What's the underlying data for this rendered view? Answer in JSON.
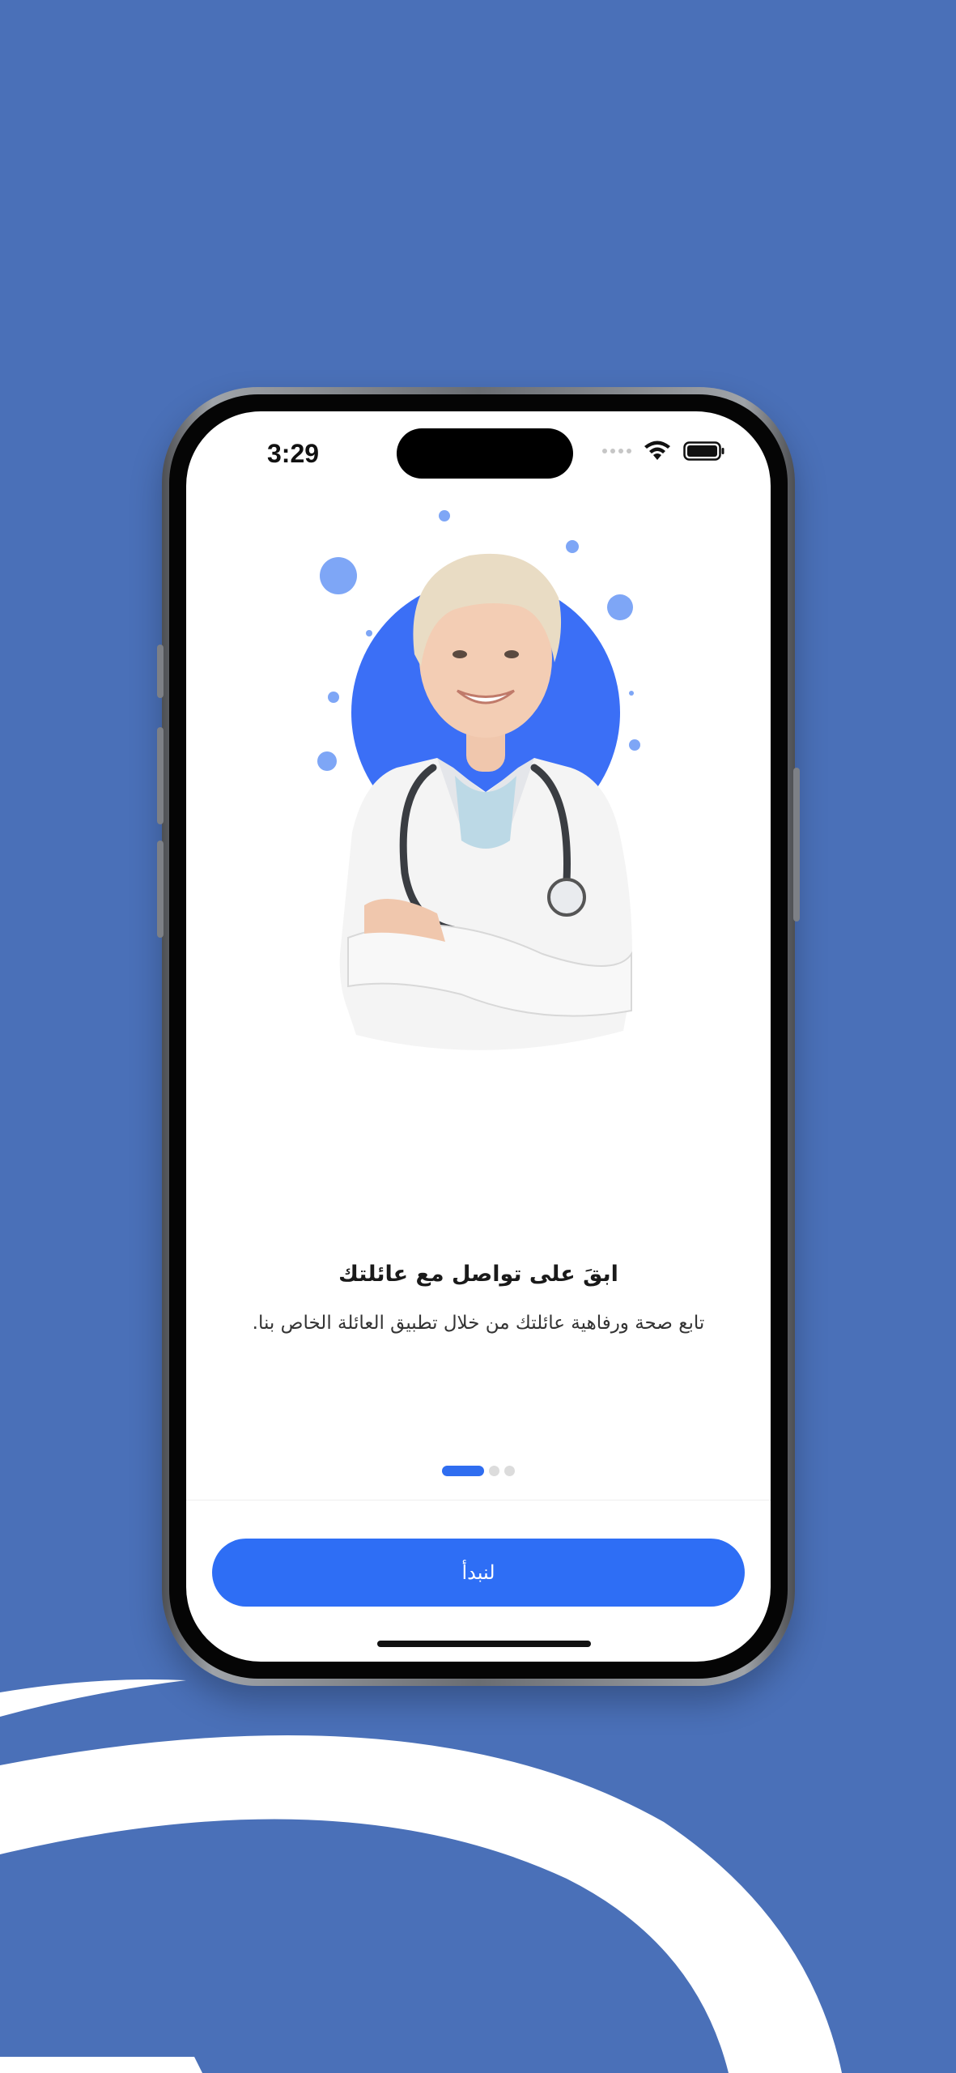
{
  "status_bar": {
    "time": "3:29"
  },
  "onboarding": {
    "title": "ابقَ على تواصل مع عائلتك",
    "subtitle": "تابع صحة ورفاهية عائلتك من خلال تطبيق العائلة الخاص بنا.",
    "page_count": 3,
    "current_page": 1,
    "start_button_label": "لنبدأ"
  },
  "colors": {
    "background": "#4a70b8",
    "accent": "#2e6ef5",
    "illustration_circle": "#3b6ff6"
  },
  "icons": [
    "signal-dots-icon",
    "wifi-icon",
    "battery-icon",
    "doctor-illustration"
  ]
}
